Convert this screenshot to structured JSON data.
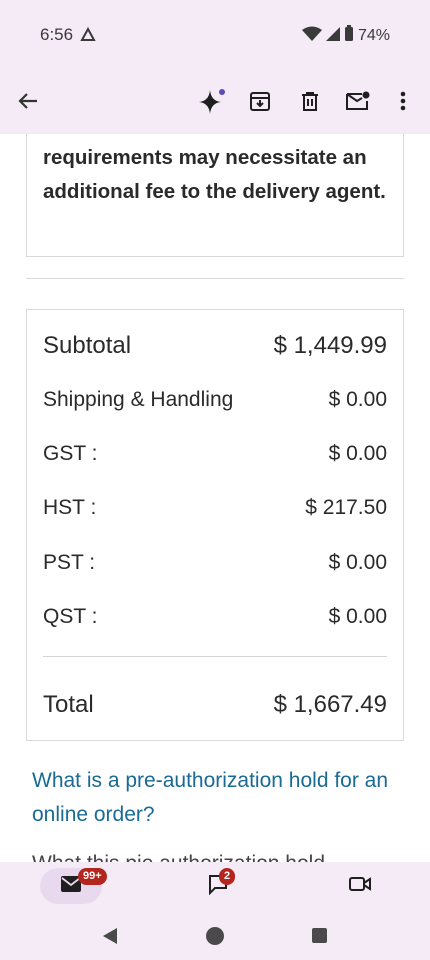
{
  "status": {
    "time": "6:56",
    "battery": "74%"
  },
  "toolbar": {
    "back_icon": "arrow-left-icon",
    "sparkle_icon": "gemini-sparkle-icon",
    "archive_icon": "archive-icon",
    "delete_icon": "trash-icon",
    "unread_icon": "mark-unread-icon",
    "more_icon": "more-vert-icon"
  },
  "notice": {
    "text": "requirements may necessitate an additional fee to the delivery agent."
  },
  "totals": {
    "subtotal_label": "Subtotal",
    "subtotal_value": "$ 1,449.99",
    "shipping_label": "Shipping & Handling",
    "shipping_value": "$ 0.00",
    "gst_label": "GST :",
    "gst_value": "$ 0.00",
    "hst_label": "HST :",
    "hst_value": "$ 217.50",
    "pst_label": "PST :",
    "pst_value": "$ 0.00",
    "qst_label": "QST :",
    "qst_value": "$ 0.00",
    "total_label": "Total",
    "total_value": "$ 1,667.49"
  },
  "link": {
    "text": "What is a pre-authorization hold for an online order?"
  },
  "cut_text": "What this pie authorization hold",
  "bottom_nav": {
    "mail_badge": "99+",
    "chat_badge": "2"
  },
  "colors": {
    "accent": "#1a6a94",
    "badge": "#b3261e",
    "chrome": "#f4ebf6"
  }
}
